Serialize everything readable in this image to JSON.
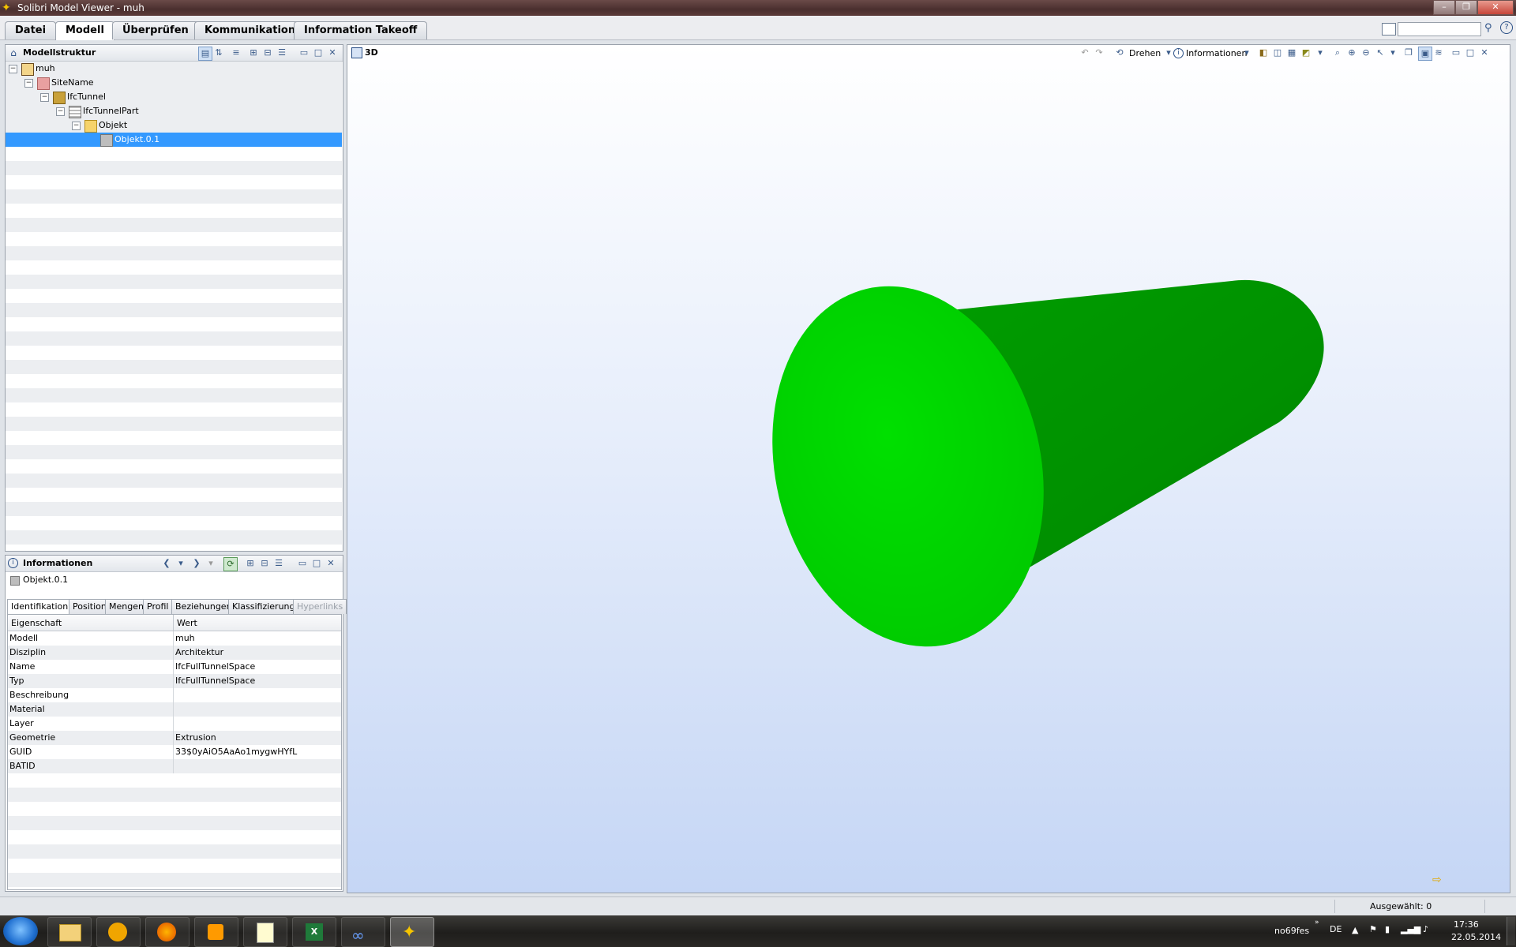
{
  "window": {
    "title": "Solibri Model Viewer - muh",
    "controls": [
      "–",
      "❐",
      "✕"
    ]
  },
  "menu": {
    "tabs": [
      "Datei",
      "Modell",
      "Überprüfen",
      "Kommunikation",
      "Information Takeoff"
    ],
    "active": "Modell"
  },
  "model_tree": {
    "title": "Modellstruktur",
    "nodes": [
      {
        "label": "muh",
        "level": 0,
        "icon": "house-icon"
      },
      {
        "label": "SiteName",
        "level": 1,
        "icon": "site-icon"
      },
      {
        "label": "IfcTunnel",
        "level": 2,
        "icon": "building-icon"
      },
      {
        "label": "IfcTunnelPart",
        "level": 3,
        "icon": "storey-icon"
      },
      {
        "label": "Objekt",
        "level": 4,
        "icon": "folder-icon"
      },
      {
        "label": "Objekt.0.1",
        "level": 5,
        "icon": "object-icon",
        "selected": true
      }
    ]
  },
  "info_panel": {
    "title": "Informationen",
    "object_name": "Objekt.0.1",
    "tabs": [
      "Identifikation",
      "Position",
      "Mengen",
      "Profil",
      "Beziehungen",
      "Klassifizierung",
      "Hyperlinks"
    ],
    "active_tab": "Identifikation",
    "disabled_tab": "Hyperlinks",
    "columns": [
      "Eigenschaft",
      "Wert"
    ],
    "properties": [
      {
        "key": "Modell",
        "value": "muh"
      },
      {
        "key": "Disziplin",
        "value": "Architektur"
      },
      {
        "key": "Name",
        "value": "IfcFullTunnelSpace"
      },
      {
        "key": "Typ",
        "value": "IfcFullTunnelSpace"
      },
      {
        "key": "Beschreibung",
        "value": ""
      },
      {
        "key": "Material",
        "value": ""
      },
      {
        "key": "Layer",
        "value": ""
      },
      {
        "key": "Geometrie",
        "value": "Extrusion"
      },
      {
        "key": "GUID",
        "value": "33$0yAiO5AaAo1mygwHYfL"
      },
      {
        "key": "BATID",
        "value": ""
      }
    ]
  },
  "view3d": {
    "title": "3D",
    "rotate_label": "Drehen",
    "info_label": "Informationen",
    "colors": {
      "cylinder_face": "#00dd00",
      "cylinder_side": "#009a00"
    }
  },
  "status": {
    "selected": "Ausgewählt: 0"
  },
  "taskbar": {
    "user": "no69fes",
    "lang": "DE",
    "time": "17:36",
    "date": "22.05.2014"
  }
}
